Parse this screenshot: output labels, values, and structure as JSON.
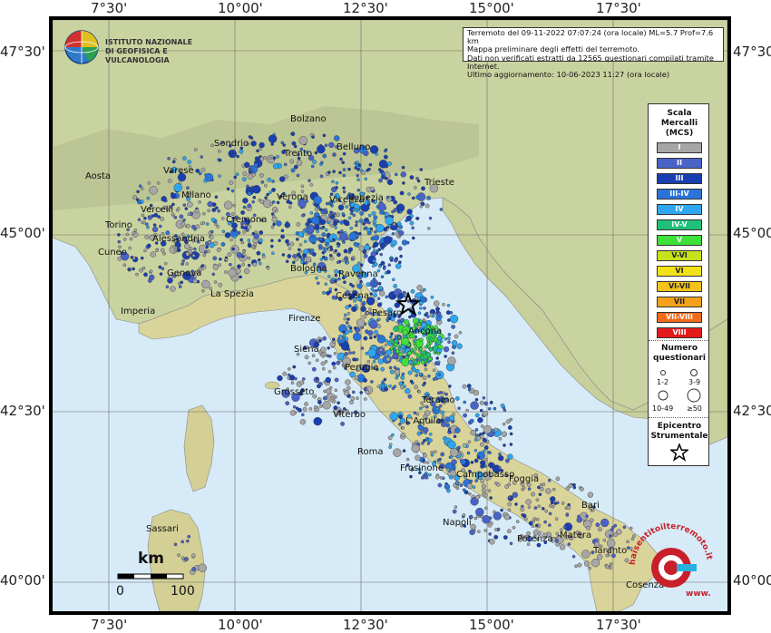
{
  "header": {
    "lines": [
      "Terremoto del 09-11-2022 07:07:24 (ora locale) ML=5.7 Prof=7.6 km",
      "Mappa preliminare degli effetti del terremoto.",
      "Dati non verificati estratti da 12565 questionari compilati tramite Internet.",
      "Ultimo aggiornamento: 10-06-2023 11:27 (ora locale)"
    ]
  },
  "logo": {
    "line1": "ISTITUTO NAZIONALE",
    "line2": "DI GEOFISICA E VULCANOLOGIA",
    "icon": "ingv-globe-icon"
  },
  "axes": {
    "top": [
      "7°30'",
      "10°00'",
      "12°30'",
      "15°00'",
      "17°30'"
    ],
    "bottom": [
      "7°30'",
      "10°00'",
      "12°30'",
      "15°00'",
      "17°30'"
    ],
    "left": [
      "47°30'",
      "45°00'",
      "42°30'",
      "40°00'"
    ],
    "right": [
      "47°30'",
      "45°00'",
      "42°30'",
      "40°00'"
    ]
  },
  "legend": {
    "mcs_title": [
      "Scala",
      "Mercalli",
      "(MCS)"
    ],
    "classes": [
      {
        "label": "I",
        "color": "#a6a6a6"
      },
      {
        "label": "II",
        "color": "#4a63c8"
      },
      {
        "label": "III",
        "color": "#1a3fb0"
      },
      {
        "label": "III-IV",
        "color": "#2a74d8"
      },
      {
        "label": "IV",
        "color": "#2ea6f0"
      },
      {
        "label": "IV-V",
        "color": "#20c07a"
      },
      {
        "label": "V",
        "color": "#3ee03a"
      },
      {
        "label": "V-VI",
        "color": "#c6e21a"
      },
      {
        "label": "VI",
        "color": "#f2e21a"
      },
      {
        "label": "VI-VII",
        "color": "#f2c41a"
      },
      {
        "label": "VII",
        "color": "#f2a21a"
      },
      {
        "label": "VII-VIII",
        "color": "#f26a1a"
      },
      {
        "label": "VIII",
        "color": "#e41a1a"
      }
    ],
    "count_title": [
      "Numero",
      "questionari"
    ],
    "count_labels": [
      "1-2",
      "3-9",
      "10-49",
      "≥50"
    ],
    "epicenter_title": [
      "Epicentro",
      "Strumentale"
    ]
  },
  "scale": {
    "unit": "km",
    "zero": "0",
    "max": "100"
  },
  "cities": [
    "Bolzano",
    "Belluno",
    "Sondrio",
    "Trento",
    "Aosta",
    "Varese",
    "Vicenza",
    "Trieste",
    "Milano",
    "Verona",
    "Venezia",
    "Vercelli",
    "Torino",
    "Cremona",
    "Alessandria",
    "Ravenna",
    "Bologna",
    "Genova",
    "Cuneo",
    "La Spezia",
    "Cesena",
    "Imperia",
    "Pesaro",
    "Ancona",
    "Firenze",
    "Siena",
    "Perugia",
    "Grosseto",
    "Teramo",
    "Viterbo",
    "L'Aquila",
    "Roma",
    "Frosinone",
    "Campobasso",
    "Foggia",
    "Bari",
    "Napoli",
    "Matera",
    "Potenza",
    "Taranto",
    "Sassari",
    "Cosenza"
  ],
  "watermark": {
    "text": "haisentitoilterremoto.it",
    "sub": "www.",
    "icon": "seismometer-logo-icon"
  }
}
